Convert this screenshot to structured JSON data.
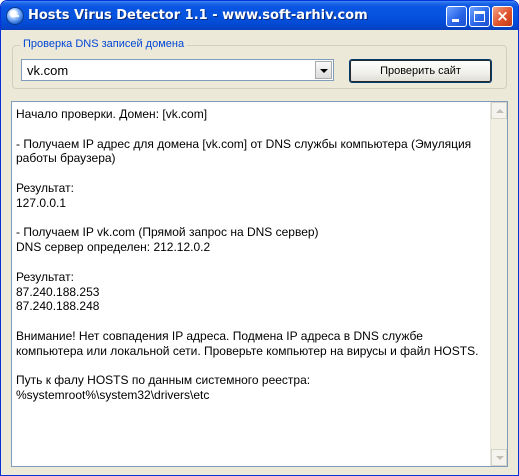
{
  "window": {
    "title": "Hosts Virus Detector 1.1 - www.soft-arhiv.com",
    "icon": "app-globe-icon",
    "controls": {
      "minimize": "minimize-icon",
      "maximize": "maximize-icon",
      "close_glyph": "×"
    }
  },
  "dns_check": {
    "group_label": "Проверка DNS записей домена",
    "domain_value": "vk.com",
    "check_button_label": "Проверить сайт"
  },
  "log": {
    "lines": [
      "Начало проверки. Домен: [vk.com]",
      "",
      "- Получаем IP адрес для домена [vk.com] от DNS службы компьютера (Эмуляция",
      "работы браузера)",
      "",
      "Результат:",
      "127.0.0.1",
      "",
      "- Получаем IP vk.com (Прямой запрос на DNS сервер)",
      "DNS сервер определен: 212.12.0.2",
      "",
      "Результат:",
      "87.240.188.253",
      "87.240.188.248",
      "",
      "Внимание! Нет совпадения IP адреса. Подмена IP адреса в DNS службе",
      "компьютера или локальной сети. Проверьте компьютер на вирусы и файл HOSTS.",
      "",
      "Путь к фалу HOSTS по данным системного реестра:",
      "%systemroot%\\system32\\drivers\\etc"
    ]
  },
  "colors": {
    "titlebar": "#0654e0",
    "window_bg": "#ece9d8",
    "group_label": "#0046d5"
  }
}
